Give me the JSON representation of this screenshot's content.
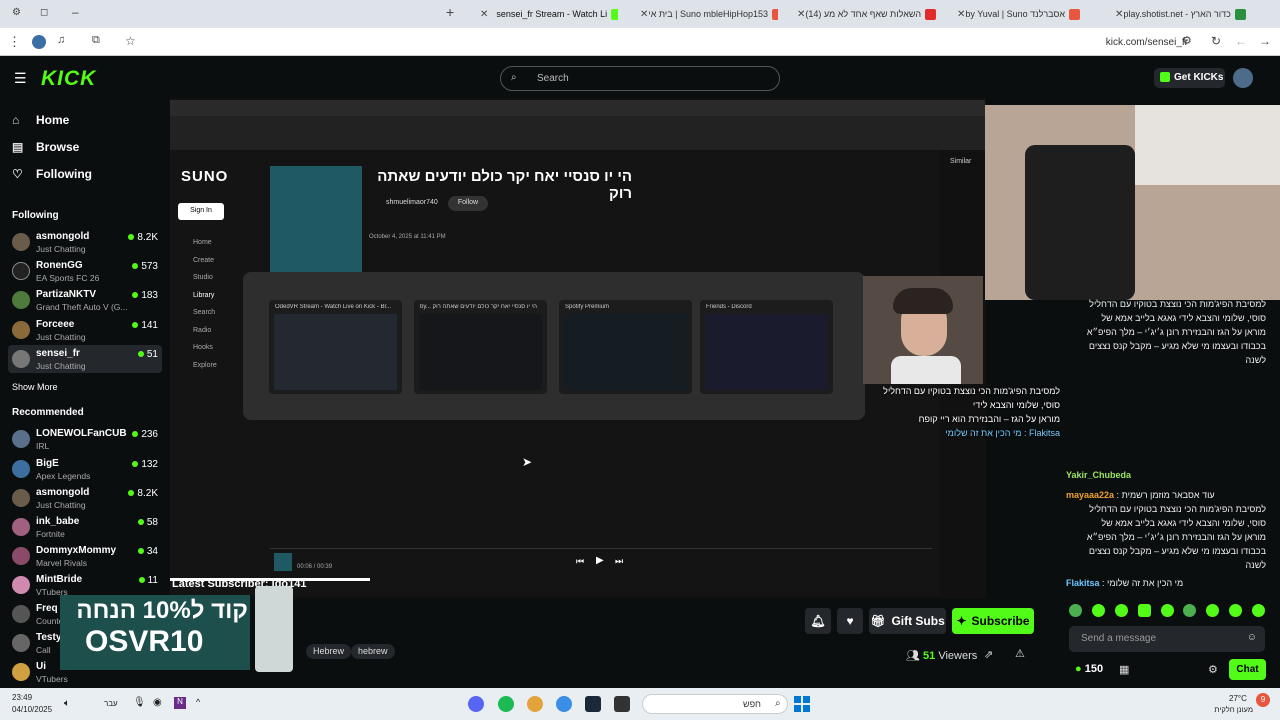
{
  "browser": {
    "tabs": [
      {
        "label": "",
        "color": "#666"
      },
      {
        "label": "sensei_fr Stream - Watch Li",
        "color": "#53fc18",
        "active": true
      },
      {
        "label": "בית אי | Suno mbleHipHop153",
        "color": "#e8573d"
      },
      {
        "label": "השאלות שאף אחד לא מע (14)",
        "color": "#e02b2b"
      },
      {
        "label": "by Yuval | Suno אסברלנד",
        "color": "#e8573d"
      },
      {
        "label": "play.shotist.net - כדור הארץ",
        "color": "#2a8f3e"
      }
    ],
    "url": "kick.com/sensei_fr"
  },
  "header": {
    "logo": "KICK",
    "search_placeholder": "Search",
    "get_kicks": "Get KICKs"
  },
  "sidebar": {
    "nav": [
      {
        "label": "Home",
        "icon": "home-icon"
      },
      {
        "label": "Browse",
        "icon": "browse-icon"
      },
      {
        "label": "Following",
        "icon": "heart-icon"
      }
    ],
    "following_title": "Following",
    "following": [
      {
        "name": "asmongold",
        "game": "Just Chatting",
        "viewers": "8.2K",
        "color": "#6b5b4a"
      },
      {
        "name": "RonenGG",
        "game": "EA Sports FC 26",
        "viewers": "573",
        "color": "#222"
      },
      {
        "name": "PartizaNKTV",
        "game": "Grand Theft Auto V (G...",
        "viewers": "183",
        "color": "#4e7a3c"
      },
      {
        "name": "Forceee",
        "game": "Just Chatting",
        "viewers": "141",
        "color": "#8a6a3a"
      },
      {
        "name": "sensei_fr",
        "game": "Just Chatting",
        "viewers": "51",
        "color": "#777",
        "selected": true
      }
    ],
    "show_more": "Show More",
    "recommended_title": "Recommended",
    "recommended": [
      {
        "name": "LONEWOLFanCUB",
        "game": "IRL",
        "viewers": "236",
        "color": "#5a6f8a"
      },
      {
        "name": "BigE",
        "game": "Apex Legends",
        "viewers": "132",
        "color": "#3c6fa0"
      },
      {
        "name": "asmongold",
        "game": "Just Chatting",
        "viewers": "8.2K",
        "color": "#6b5b4a"
      },
      {
        "name": "ink_babe",
        "game": "Fortnite",
        "viewers": "58",
        "color": "#a06080"
      },
      {
        "name": "DommyxMommy",
        "game": "Marvel Rivals",
        "viewers": "34",
        "color": "#8a4a6a"
      },
      {
        "name": "MintBride",
        "game": "VTubers",
        "viewers": "11",
        "color": "#d08ab0"
      },
      {
        "name": "Freq",
        "game": "Counter-Strike 2",
        "viewers": "",
        "color": "#555"
      },
      {
        "name": "Testy",
        "game": "Call",
        "viewers": "",
        "color": "#666"
      },
      {
        "name": "Ui",
        "game": "VTubers",
        "viewers": "",
        "color": "#d0a040"
      }
    ]
  },
  "video": {
    "suno_logo": "SUNO",
    "song_title": "הי יו סנסיי יאח יקר כולם יודעים שאתה רוק",
    "artist": "shmuelimaor740",
    "follow": "Follow",
    "date": "October 4, 2025 at 11:41 PM",
    "sign_in": "Sign In",
    "menu": [
      "Home",
      "Create",
      "Studio",
      "Library",
      "Search",
      "Radio",
      "Hooks",
      "Explore"
    ],
    "player_time": "00:06 / 00:39",
    "windows": [
      "OdedVR Stream - Watch Live on Kick - Br...",
      "by... הי יו סנסיי יאח יקר כולם יודעים שאתה רוק",
      "Spotify Premium",
      "Friends - Discord"
    ],
    "similar": "Similar",
    "overlay_lines": [
      "למסיבת הפיג'מות הכי נוצצת בטוקיו עם הדחליל",
      "סוסי, שלומי והצבא לידי",
      "מוראן על הגז – והבנזירת הוא ריי קופח",
      "Flakitsa : מי הכין את זה שלומי"
    ]
  },
  "below": {
    "latest_sub": "Latest Subscriber: ido141",
    "promo_line1": "קוד ל10% הנחה",
    "promo_line2": "OSVR10",
    "tags": [
      "Hebrew",
      "hebrew"
    ],
    "viewers": "51",
    "viewers_label": "Viewers",
    "gift_subs": "Gift Subs",
    "subscribe": "Subscribe"
  },
  "chat": {
    "messages": [
      {
        "user": "",
        "text": "למסיבת הפיג'מות הכי נוצצת בטוקיו עם הדחליל"
      },
      {
        "user": "",
        "text": "סוסי, שלומי והצבא לידי גאגא בלייב אמא של"
      },
      {
        "user": "",
        "text": "מוראן על הגז והבנזירת רונן ג׳יג׳י – מלך הפיפ״א"
      },
      {
        "user": "",
        "text": "בכבודו ובעצמו מי שלא מגיע – מקבל קנס נצצים"
      },
      {
        "user": "",
        "text": "לשנה"
      },
      {
        "user": "Yakir_Chubeda",
        "text": ""
      },
      {
        "user": "mayaaa22a",
        "text": "עוד אסבאר מוזמן רשמית"
      },
      {
        "user": "",
        "text": "למסיבת הפיג'מות הכי נוצצת בטוקיו עם הדחליל"
      },
      {
        "user": "",
        "text": "סוסי, שלומי והצבא לידי גאגא בלייב אמא של"
      },
      {
        "user": "",
        "text": "מוראן על הגז והבנזירת רונן ג׳יג׳י – מלך הפיפ״א"
      },
      {
        "user": "",
        "text": "בכבודו ובעצמו מי שלא מגיע – מקבל קנס נצצים"
      },
      {
        "user": "",
        "text": "לשנה"
      },
      {
        "user": "Flakitsa",
        "text": "מי הכין את זה שלומי"
      }
    ],
    "input_placeholder": "Send a message",
    "points": "150",
    "chat_button": "Chat"
  },
  "taskbar": {
    "time": "23:49",
    "date": "04/10/2025",
    "lang": "עבר",
    "search": "חפש",
    "weather_temp": "27°C",
    "weather_desc": "מעונן חלקית",
    "notif_count": "9"
  }
}
